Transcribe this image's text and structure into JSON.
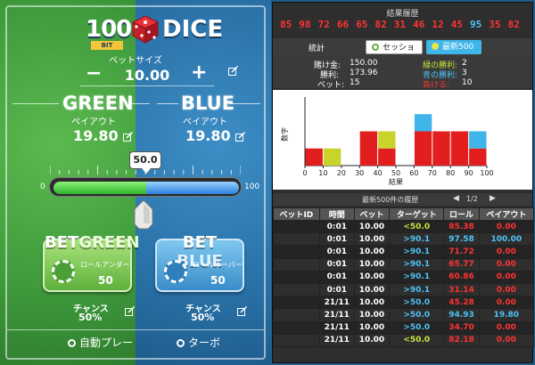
{
  "logo": {
    "number": "100",
    "bit": "BIT",
    "name": "DICE"
  },
  "bet_size": {
    "label": "ベットサイズ",
    "minus": "−",
    "plus": "+",
    "value": "10.00"
  },
  "green": {
    "title": "GREEN",
    "payout_label": "ペイアウト",
    "payout": "19.80"
  },
  "blue": {
    "title": "BLUE",
    "payout_label": "ペイアウト",
    "payout": "19.80"
  },
  "slider": {
    "value_label": "50.0",
    "value": 50,
    "min_label": "0",
    "max_label": "100"
  },
  "bet_green": {
    "title_a": "BET",
    "title_b": "GREEN",
    "sub": "ロールアンダー",
    "num": "50",
    "chance_label": "チャンス",
    "chance": "50%"
  },
  "bet_blue": {
    "title_a": "BET",
    "title_b": "BLUE",
    "sub": "ロールオーバー",
    "num": "50",
    "chance_label": "チャンス",
    "chance": "50%"
  },
  "options": {
    "auto_play": "自動プレー",
    "turbo": "ターボ"
  },
  "results": {
    "title": "結果履歴",
    "values": [
      {
        "v": "85",
        "color": "#ff3333"
      },
      {
        "v": "98",
        "color": "#ff3333"
      },
      {
        "v": "72",
        "color": "#ff3333"
      },
      {
        "v": "66",
        "color": "#ff3333"
      },
      {
        "v": "65",
        "color": "#ff3333"
      },
      {
        "v": "82",
        "color": "#ff3333"
      },
      {
        "v": "31",
        "color": "#ff3333"
      },
      {
        "v": "46",
        "color": "#ff3333"
      },
      {
        "v": "12",
        "color": "#ff3333"
      },
      {
        "v": "45",
        "color": "#ff3333"
      },
      {
        "v": "95",
        "color": "#4ec3f5"
      },
      {
        "v": "35",
        "color": "#ff3333"
      },
      {
        "v": "82",
        "color": "#ff3333"
      }
    ]
  },
  "tabs": {
    "stats_label": "統計",
    "session": "セッション",
    "latest": "最新500"
  },
  "stats": {
    "wager_label": "賭け金:",
    "wager": "150.00",
    "profit_label": "勝利:",
    "profit": "173.96",
    "bets_label": "ベット:",
    "bets": "15",
    "green_wins_label": "緑の勝利:",
    "green_wins": "2",
    "blue_wins_label": "青の勝利:",
    "blue_wins": "3",
    "losses_label": "負ける:",
    "losses": "10"
  },
  "chart_data": {
    "type": "bar",
    "ylabel": "数字",
    "xlabel": "結果",
    "x_ticks": [
      "0",
      "10",
      "20",
      "30",
      "40",
      "50",
      "60",
      "70",
      "80",
      "90",
      "100"
    ],
    "ylim": [
      0,
      4
    ],
    "bins": [
      {
        "from": 0,
        "to": 10,
        "red": 1,
        "green": 0,
        "blue": 0
      },
      {
        "from": 10,
        "to": 20,
        "red": 0,
        "green": 1,
        "blue": 0
      },
      {
        "from": 20,
        "to": 30,
        "red": 0,
        "green": 0,
        "blue": 0
      },
      {
        "from": 30,
        "to": 40,
        "red": 2,
        "green": 0,
        "blue": 0
      },
      {
        "from": 40,
        "to": 50,
        "red": 1,
        "green": 1,
        "blue": 0
      },
      {
        "from": 50,
        "to": 60,
        "red": 0,
        "green": 0,
        "blue": 0
      },
      {
        "from": 60,
        "to": 70,
        "red": 2,
        "green": 0,
        "blue": 1
      },
      {
        "from": 70,
        "to": 80,
        "red": 2,
        "green": 0,
        "blue": 0
      },
      {
        "from": 80,
        "to": 90,
        "red": 2,
        "green": 0,
        "blue": 0
      },
      {
        "from": 90,
        "to": 100,
        "red": 1,
        "green": 0,
        "blue": 1
      }
    ],
    "colors": {
      "red": "#e31e1e",
      "green": "#c8d42a",
      "blue": "#3fb5e9"
    }
  },
  "history": {
    "title": "最新500件の履歴",
    "page": "1/2",
    "headers": [
      "ベットID",
      "時間",
      "ベット",
      "ターゲット",
      "ロール",
      "ペイアウト"
    ],
    "rows": [
      {
        "id": "",
        "time": "0:01",
        "bet": "10.00",
        "target": "<50.0",
        "target_c": "c-green",
        "roll": "85.38",
        "roll_c": "c-red",
        "payout": "0.00",
        "payout_c": "c-red"
      },
      {
        "id": "",
        "time": "0:01",
        "bet": "10.00",
        "target": ">90.1",
        "target_c": "c-blue",
        "roll": "97.58",
        "roll_c": "c-blue",
        "payout": "100.00",
        "payout_c": "c-blue"
      },
      {
        "id": "",
        "time": "0:01",
        "bet": "10.00",
        "target": ">90.1",
        "target_c": "c-blue",
        "roll": "71.72",
        "roll_c": "c-red",
        "payout": "0.00",
        "payout_c": "c-red"
      },
      {
        "id": "",
        "time": "0:01",
        "bet": "10.00",
        "target": ">90.1",
        "target_c": "c-blue",
        "roll": "65.77",
        "roll_c": "c-red",
        "payout": "0.00",
        "payout_c": "c-red"
      },
      {
        "id": "",
        "time": "0:01",
        "bet": "10.00",
        "target": ">90.1",
        "target_c": "c-blue",
        "roll": "60.86",
        "roll_c": "c-red",
        "payout": "0.00",
        "payout_c": "c-red"
      },
      {
        "id": "",
        "time": "0:01",
        "bet": "10.00",
        "target": ">90.1",
        "target_c": "c-blue",
        "roll": "31.14",
        "roll_c": "c-red",
        "payout": "0.00",
        "payout_c": "c-red"
      },
      {
        "id": "",
        "time": "21/11",
        "bet": "10.00",
        "target": ">50.0",
        "target_c": "c-blue",
        "roll": "45.28",
        "roll_c": "c-red",
        "payout": "0.00",
        "payout_c": "c-red"
      },
      {
        "id": "",
        "time": "21/11",
        "bet": "10.00",
        "target": ">50.0",
        "target_c": "c-blue",
        "roll": "94.93",
        "roll_c": "c-blue",
        "payout": "19.80",
        "payout_c": "c-blue"
      },
      {
        "id": "",
        "time": "21/11",
        "bet": "10.00",
        "target": ">50.0",
        "target_c": "c-blue",
        "roll": "34.70",
        "roll_c": "c-red",
        "payout": "0.00",
        "payout_c": "c-red"
      },
      {
        "id": "",
        "time": "21/11",
        "bet": "10.00",
        "target": "<50.0",
        "target_c": "c-green",
        "roll": "82.18",
        "roll_c": "c-red",
        "payout": "0.00",
        "payout_c": "c-red"
      }
    ]
  }
}
